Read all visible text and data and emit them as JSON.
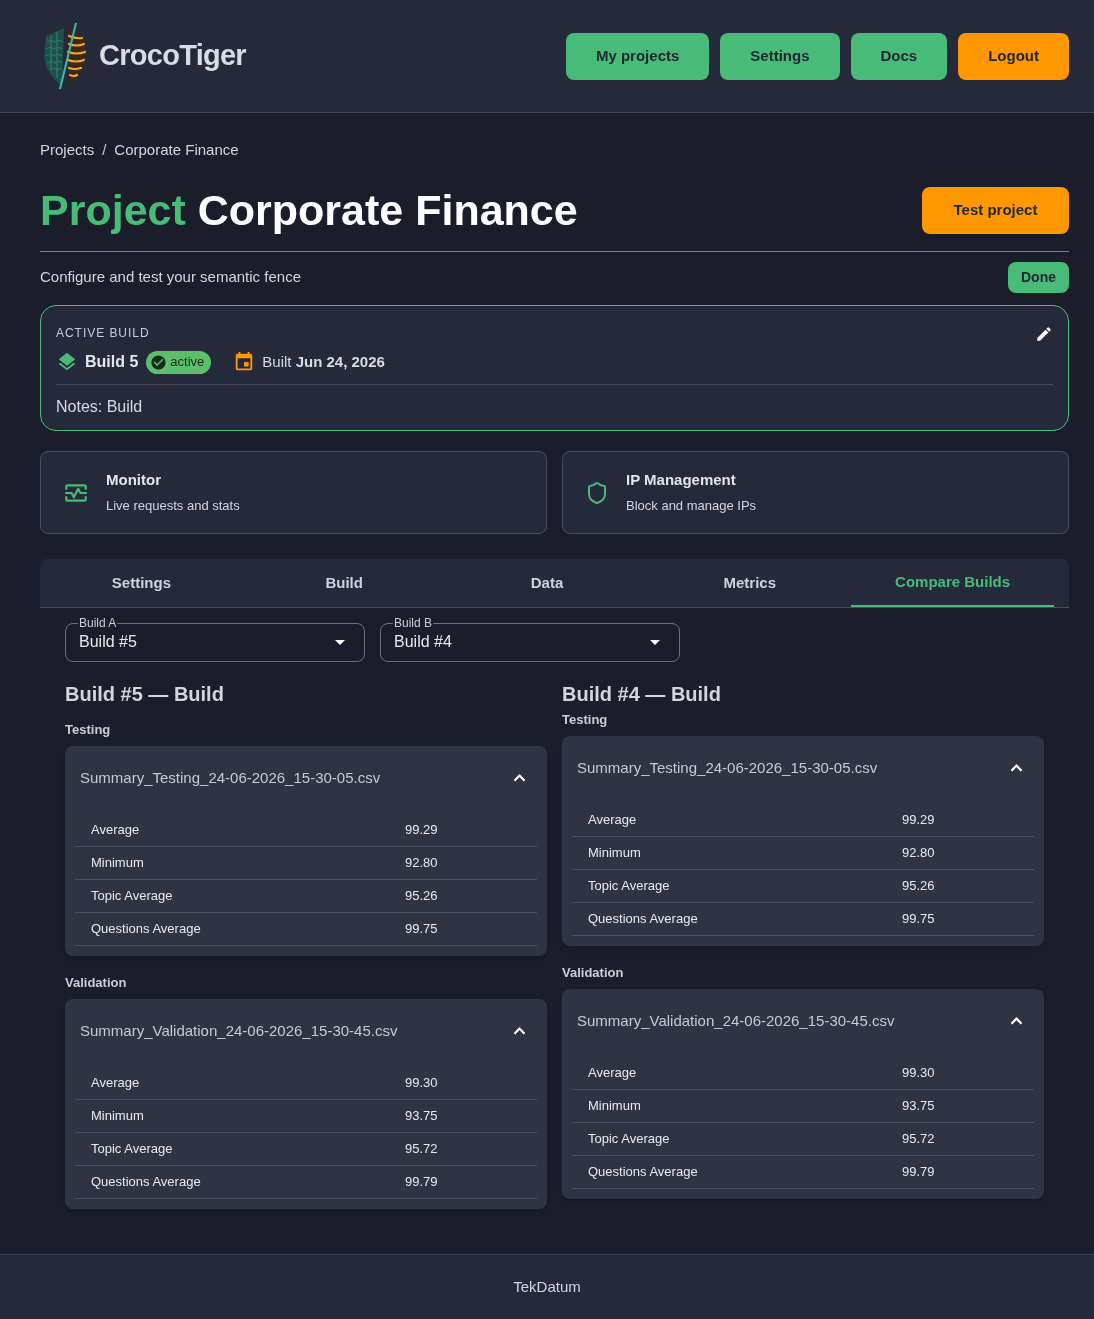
{
  "header": {
    "logo_text": "CrocoTiger",
    "nav": [
      {
        "label": "My projects",
        "kind": "primary"
      },
      {
        "label": "Settings",
        "kind": "primary"
      },
      {
        "label": "Docs",
        "kind": "primary"
      },
      {
        "label": "Logout",
        "kind": "warning"
      }
    ]
  },
  "breadcrumb": {
    "items": [
      "Projects",
      "Corporate Finance"
    ],
    "separator": "/"
  },
  "title": {
    "prefix": "Project",
    "name": "Corporate Finance"
  },
  "test_button": "Test project",
  "subtitle": "Configure and test your semantic fence",
  "status_badge": "Done",
  "active_build": {
    "heading": "ACTIVE BUILD",
    "build": "Build 5",
    "badge": "active",
    "built": "Built **Jun 24, 2026**",
    "notes": "Notes: Build"
  },
  "shortcuts": [
    {
      "kind": "monitor",
      "title": "Monitor",
      "subtitle": "Live requests and stats"
    },
    {
      "kind": "shield",
      "title": "IP Management",
      "subtitle": "Block and manage IPs"
    }
  ],
  "tabs": [
    {
      "label": "Settings",
      "selected": false
    },
    {
      "label": "Build",
      "selected": false
    },
    {
      "label": "Data",
      "selected": false
    },
    {
      "label": "Metrics",
      "selected": false
    },
    {
      "label": "Compare Builds",
      "selected": true
    }
  ],
  "selects": [
    {
      "label": "Build A",
      "value": "Build #5"
    },
    {
      "label": "Build B",
      "value": "Build #4"
    }
  ],
  "columns": [
    {
      "heading": "Build #5 — Build",
      "sections": [
        {
          "label": "Testing",
          "file": "Summary_Testing_24-06-2026_15-30-05.csv",
          "expanded": true,
          "rows": [
            {
              "name": "Average",
              "value": "99.29"
            },
            {
              "name": "Minimum",
              "value": "92.80"
            },
            {
              "name": "Topic Average",
              "value": "95.26"
            },
            {
              "name": "Questions Average",
              "value": "99.75"
            }
          ]
        },
        {
          "label": "Validation",
          "file": "Summary_Validation_24-06-2026_15-30-45.csv",
          "expanded": true,
          "rows": [
            {
              "name": "Average",
              "value": "99.30"
            },
            {
              "name": "Minimum",
              "value": "93.75"
            },
            {
              "name": "Topic Average",
              "value": "95.72"
            },
            {
              "name": "Questions Average",
              "value": "99.79"
            }
          ]
        }
      ]
    },
    {
      "heading": "Build #4 — Build",
      "sections": [
        {
          "label": "Testing",
          "file": "Summary_Testing_24-06-2026_15-30-05.csv",
          "expanded": true,
          "rows": [
            {
              "name": "Average",
              "value": "99.29"
            },
            {
              "name": "Minimum",
              "value": "92.80"
            },
            {
              "name": "Topic Average",
              "value": "95.26"
            },
            {
              "name": "Questions Average",
              "value": "99.75"
            }
          ]
        },
        {
          "label": "Validation",
          "file": "Summary_Validation_24-06-2026_15-30-45.csv",
          "expanded": true,
          "rows": [
            {
              "name": "Average",
              "value": "99.30"
            },
            {
              "name": "Minimum",
              "value": "93.75"
            },
            {
              "name": "Topic Average",
              "value": "95.72"
            },
            {
              "name": "Questions Average",
              "value": "99.79"
            }
          ]
        }
      ]
    }
  ],
  "footer": "TekDatum"
}
